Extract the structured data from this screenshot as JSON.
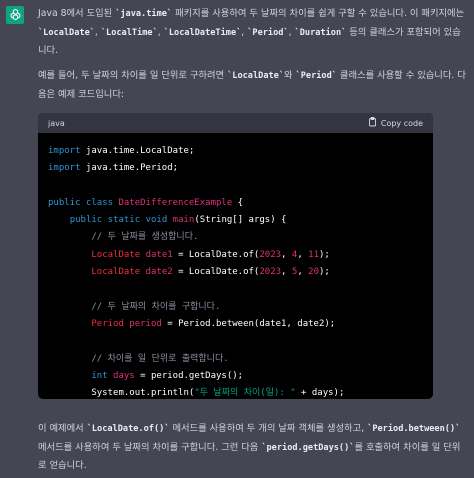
{
  "assistant": {
    "avatar_icon": "openai-logo-icon",
    "avatar_color": "#10a37f"
  },
  "paragraphs": {
    "intro": [
      {
        "t": "Java 8에서 도입된 ",
        "code": false
      },
      {
        "t": "`java.time`",
        "code": true
      },
      {
        "t": " 패키지를 사용하여 두 날짜의 차이를 쉽게 구할 수 있습니다. 이 패키지에는 ",
        "code": false
      },
      {
        "t": "`LocalDate`",
        "code": true
      },
      {
        "t": ", ",
        "code": false
      },
      {
        "t": "`LocalTime`",
        "code": true
      },
      {
        "t": ", ",
        "code": false
      },
      {
        "t": "`LocalDateTime`",
        "code": true
      },
      {
        "t": ", ",
        "code": false
      },
      {
        "t": "`Period`",
        "code": true
      },
      {
        "t": ", ",
        "code": false
      },
      {
        "t": "`Duration`",
        "code": true
      },
      {
        "t": " 등의 클래스가 포함되어 있습니다.",
        "code": false
      }
    ],
    "example": [
      {
        "t": "예를 들어, 두 날짜의 차이를 일 단위로 구하려면 ",
        "code": false
      },
      {
        "t": "`LocalDate`",
        "code": true
      },
      {
        "t": "와 ",
        "code": false
      },
      {
        "t": "`Period`",
        "code": true
      },
      {
        "t": " 클래스를 사용할 수 있습니다. 다음은 예제 코드입니다:",
        "code": false
      }
    ],
    "outro": [
      {
        "t": "이 예제에서 ",
        "code": false
      },
      {
        "t": "`LocalDate.of()`",
        "code": true
      },
      {
        "t": " 메서드를 사용하여 두 개의 날짜 객체를 생성하고, ",
        "code": false
      },
      {
        "t": "`Period.between()`",
        "code": true
      },
      {
        "t": " 메서드를 사용하여 두 날짜의 차이를 구합니다. 그런 다음 ",
        "code": false
      },
      {
        "t": "`period.getDays()`",
        "code": true
      },
      {
        "t": "를 호출하여 차이를 일 단위로 얻습니다.",
        "code": false
      }
    ]
  },
  "codeblock": {
    "language": "java",
    "copy_label": "Copy code",
    "copy_icon": "clipboard-icon",
    "lines": [
      [
        {
          "t": "import",
          "c": "kw"
        },
        {
          "t": " java.time.LocalDate;",
          "c": "plain"
        }
      ],
      [
        {
          "t": "import",
          "c": "kw"
        },
        {
          "t": " java.time.Period;",
          "c": "plain"
        }
      ],
      [],
      [
        {
          "t": "public",
          "c": "kw"
        },
        {
          "t": " ",
          "c": "plain"
        },
        {
          "t": "class",
          "c": "kw"
        },
        {
          "t": " ",
          "c": "plain"
        },
        {
          "t": "DateDifferenceExample",
          "c": "cls"
        },
        {
          "t": " {",
          "c": "plain"
        }
      ],
      [
        {
          "t": "    ",
          "c": "plain"
        },
        {
          "t": "public",
          "c": "kw"
        },
        {
          "t": " ",
          "c": "plain"
        },
        {
          "t": "static",
          "c": "kw"
        },
        {
          "t": " ",
          "c": "plain"
        },
        {
          "t": "void",
          "c": "kw"
        },
        {
          "t": " ",
          "c": "plain"
        },
        {
          "t": "main",
          "c": "cls"
        },
        {
          "t": "(String[] args) {",
          "c": "plain"
        }
      ],
      [
        {
          "t": "        ",
          "c": "plain"
        },
        {
          "t": "// 두 날짜를 생성합니다.",
          "c": "cmt"
        }
      ],
      [
        {
          "t": "        ",
          "c": "plain"
        },
        {
          "t": "LocalDate",
          "c": "ty"
        },
        {
          "t": " ",
          "c": "plain"
        },
        {
          "t": "date1",
          "c": "var"
        },
        {
          "t": " = LocalDate.of(",
          "c": "plain"
        },
        {
          "t": "2023",
          "c": "num"
        },
        {
          "t": ", ",
          "c": "plain"
        },
        {
          "t": "4",
          "c": "num"
        },
        {
          "t": ", ",
          "c": "plain"
        },
        {
          "t": "11",
          "c": "num"
        },
        {
          "t": ");",
          "c": "plain"
        }
      ],
      [
        {
          "t": "        ",
          "c": "plain"
        },
        {
          "t": "LocalDate",
          "c": "ty"
        },
        {
          "t": " ",
          "c": "plain"
        },
        {
          "t": "date2",
          "c": "var"
        },
        {
          "t": " = LocalDate.of(",
          "c": "plain"
        },
        {
          "t": "2023",
          "c": "num"
        },
        {
          "t": ", ",
          "c": "plain"
        },
        {
          "t": "5",
          "c": "num"
        },
        {
          "t": ", ",
          "c": "plain"
        },
        {
          "t": "20",
          "c": "num"
        },
        {
          "t": ");",
          "c": "plain"
        }
      ],
      [],
      [
        {
          "t": "        ",
          "c": "plain"
        },
        {
          "t": "// 두 날짜의 차이를 구합니다.",
          "c": "cmt"
        }
      ],
      [
        {
          "t": "        ",
          "c": "plain"
        },
        {
          "t": "Period",
          "c": "ty"
        },
        {
          "t": " ",
          "c": "plain"
        },
        {
          "t": "period",
          "c": "var"
        },
        {
          "t": " = Period.between(date1, date2);",
          "c": "plain"
        }
      ],
      [],
      [
        {
          "t": "        ",
          "c": "plain"
        },
        {
          "t": "// 차이를 일 단위로 출력합니다.",
          "c": "cmt"
        }
      ],
      [
        {
          "t": "        ",
          "c": "plain"
        },
        {
          "t": "int",
          "c": "kw"
        },
        {
          "t": " ",
          "c": "plain"
        },
        {
          "t": "days",
          "c": "var"
        },
        {
          "t": " = period.getDays();",
          "c": "plain"
        }
      ],
      [
        {
          "t": "        System.out.println(",
          "c": "plain"
        },
        {
          "t": "\"두 날짜의 차이(일): \"",
          "c": "str"
        },
        {
          "t": " + days);",
          "c": "plain"
        }
      ],
      [
        {
          "t": "    }",
          "c": "plain"
        }
      ],
      [
        {
          "t": "}",
          "c": "plain"
        }
      ]
    ]
  }
}
